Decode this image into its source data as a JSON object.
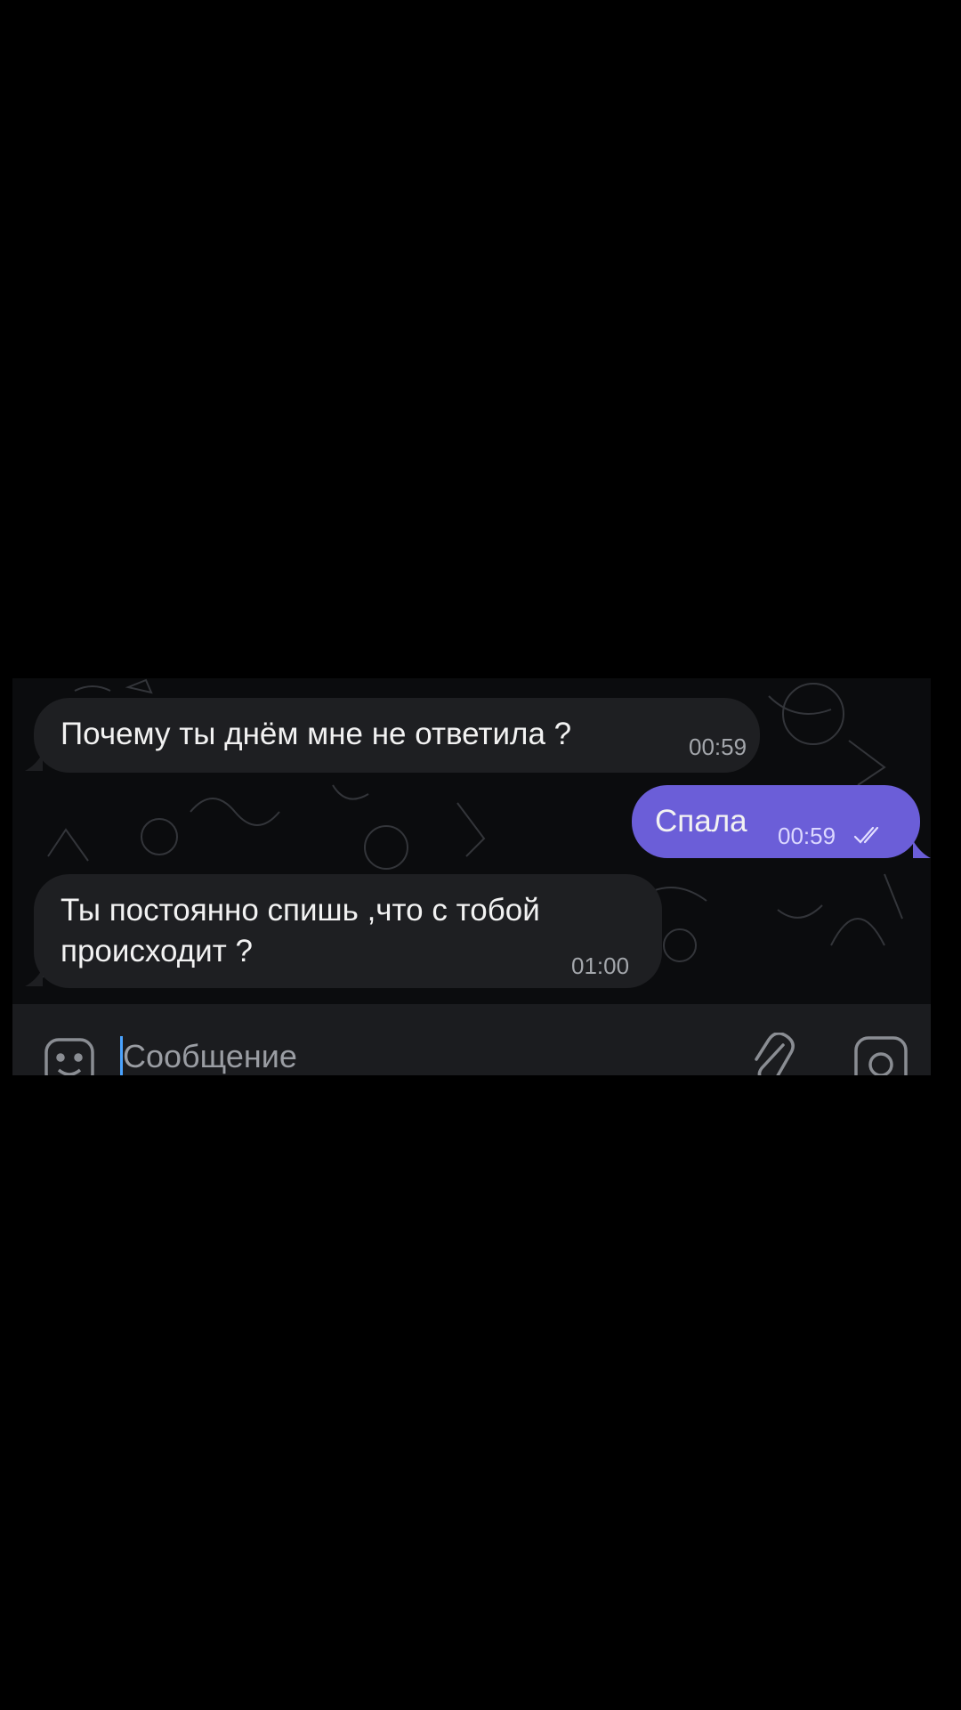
{
  "messages": [
    {
      "direction": "incoming",
      "text": "Почему ты днём мне не ответила ?",
      "time": "00:59"
    },
    {
      "direction": "outgoing",
      "text": "Спала",
      "time": "00:59",
      "status": "read"
    },
    {
      "direction": "incoming",
      "text": "Ты постоянно спишь ,что с тобой\nпроисходит ?",
      "time": "01:00"
    }
  ],
  "composer": {
    "placeholder": "Сообщение",
    "icons": [
      "emoji-icon",
      "attach-icon",
      "camera-icon"
    ]
  },
  "colors": {
    "background": "#000000",
    "chat_background": "#0b0c0e",
    "incoming_bubble": "#1e1f22",
    "outgoing_bubble": "#6b5ed8",
    "text": "#f2f2f2",
    "caret": "#4aa3ff"
  }
}
